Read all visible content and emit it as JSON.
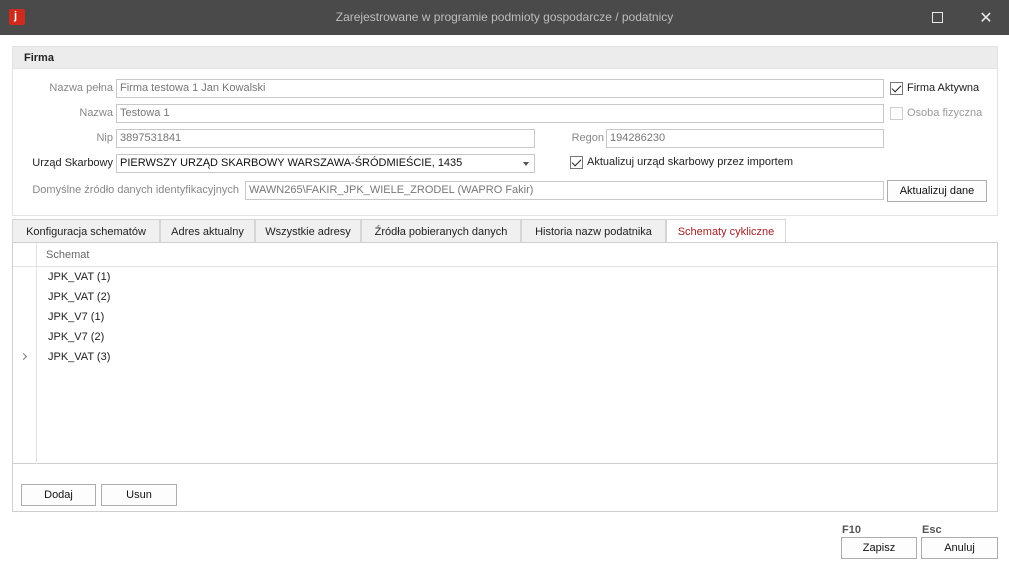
{
  "window": {
    "title": "Zarejestrowane w programie podmioty gospodarcze / podatnicy"
  },
  "firma": {
    "section_title": "Firma",
    "nazwa_pelna_label": "Nazwa pełna",
    "nazwa_pelna_value": "Firma testowa 1 Jan Kowalski",
    "nazwa_label": "Nazwa",
    "nazwa_value": "Testowa 1",
    "nip_label": "Nip",
    "nip_value": "3897531841",
    "regon_label": "Regon",
    "regon_value": "194286230",
    "urzad_label": "Urząd Skarbowy",
    "urzad_value": "PIERWSZY URZĄD SKARBOWY WARSZAWA-ŚRÓDMIEŚCIE, 1435",
    "zrodlo_label": "Domyślne źródło danych identyfikacyjnych",
    "zrodlo_value": "WAWN265\\FAKIR_JPK_WIELE_ZRODEL (WAPRO Fakir)",
    "firma_aktywna_label": "Firma Aktywna",
    "firma_aktywna_checked": true,
    "osoba_fizyczna_label": "Osoba fizyczna",
    "osoba_fizyczna_checked": false,
    "aktualizuj_us_label": "Aktualizuj urząd skarbowy przez importem",
    "aktualizuj_us_checked": true,
    "aktualizuj_dane_button": "Aktualizuj dane"
  },
  "tabs": [
    {
      "label": "Konfiguracja schematów",
      "active": false
    },
    {
      "label": "Adres aktualny",
      "active": false
    },
    {
      "label": "Wszystkie adresy",
      "active": false
    },
    {
      "label": "Źródła pobieranych danych",
      "active": false
    },
    {
      "label": "Historia nazw podatnika",
      "active": false
    },
    {
      "label": "Schematy cykliczne",
      "active": true
    }
  ],
  "grid": {
    "column_header": "Schemat",
    "rows": [
      "JPK_VAT (1)",
      "JPK_VAT (2)",
      "JPK_V7 (1)",
      "JPK_V7 (2)",
      "JPK_VAT (3)"
    ],
    "current_row_index": 4
  },
  "panel_buttons": {
    "dodaj": "Dodaj",
    "usun": "Usun"
  },
  "footer": {
    "save_key": "F10",
    "save_label": "Zapisz",
    "cancel_key": "Esc",
    "cancel_label": "Anuluj"
  },
  "colors": {
    "titlebar": "#4a4a4a",
    "active_tab_text": "#a12326",
    "app_icon": "#d02a1e"
  }
}
